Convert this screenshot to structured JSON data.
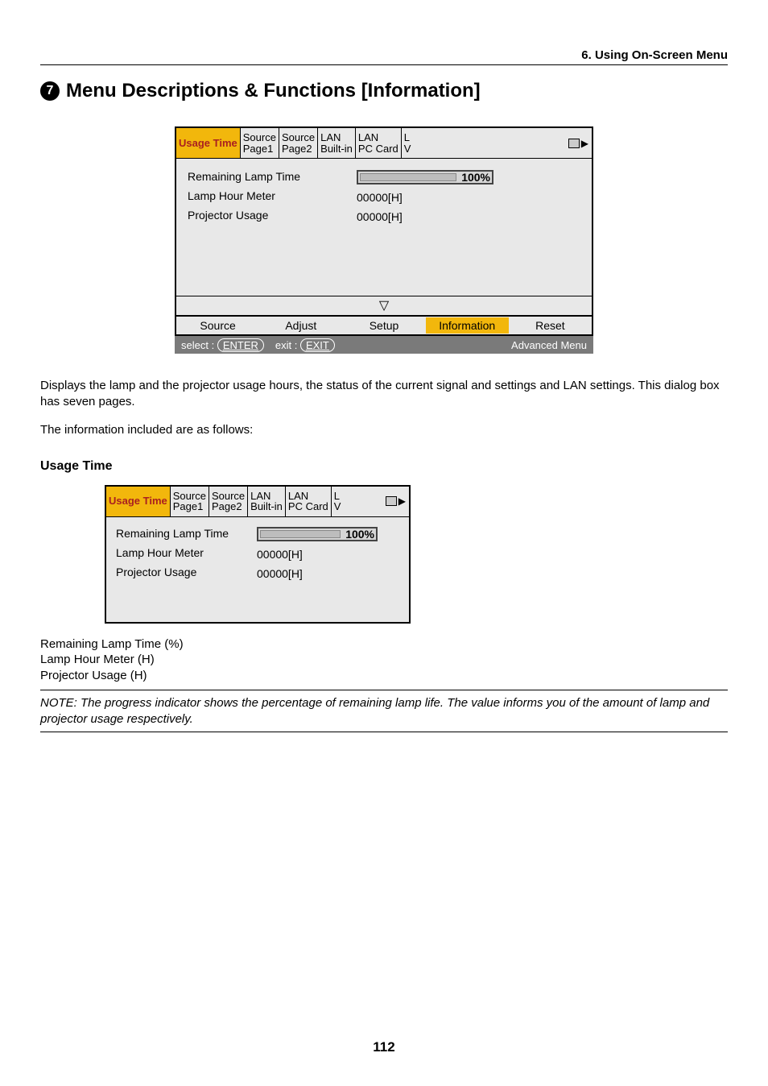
{
  "header": {
    "section_title": "6. Using On-Screen Menu"
  },
  "title": {
    "num": "7",
    "text": "Menu Descriptions & Functions [Information]"
  },
  "osd": {
    "tabs": [
      {
        "l1": "Usage Time",
        "l2": ""
      },
      {
        "l1": "Source",
        "l2": "Page1"
      },
      {
        "l1": "Source",
        "l2": "Page2"
      },
      {
        "l1": "LAN",
        "l2": "Built-in"
      },
      {
        "l1": "LAN",
        "l2": "PC Card"
      },
      {
        "l1": "L",
        "l2": "V"
      }
    ],
    "labels": {
      "remaining": "Remaining Lamp Time",
      "lamp_meter": "Lamp Hour Meter",
      "proj_usage": "Projector Usage"
    },
    "values": {
      "pct": "100%",
      "lamp_meter": "00000[H]",
      "proj_usage": "00000[H]"
    },
    "pointer": "▽",
    "menu": {
      "items": [
        "Source",
        "Adjust",
        "Setup",
        "Information",
        "Reset"
      ]
    },
    "legend": {
      "select_label": "select :",
      "select_key": "ENTER",
      "exit_label": "exit :",
      "exit_key": "EXIT",
      "right": "Advanced Menu"
    }
  },
  "paragraphs": {
    "p1": "Displays the lamp and the projector usage hours, the status of the current signal and settings and LAN settings. This dialog box has seven pages.",
    "p2": "The information included are as follows:"
  },
  "section2": {
    "head": "Usage Time"
  },
  "triple": {
    "a": "Remaining Lamp Time (%)",
    "b": "Lamp Hour Meter (H)",
    "c": "Projector Usage (H)"
  },
  "note": "NOTE: The progress indicator shows the percentage of remaining lamp life. The value informs you of the amount of lamp and projector usage respectively.",
  "page_num": "112"
}
